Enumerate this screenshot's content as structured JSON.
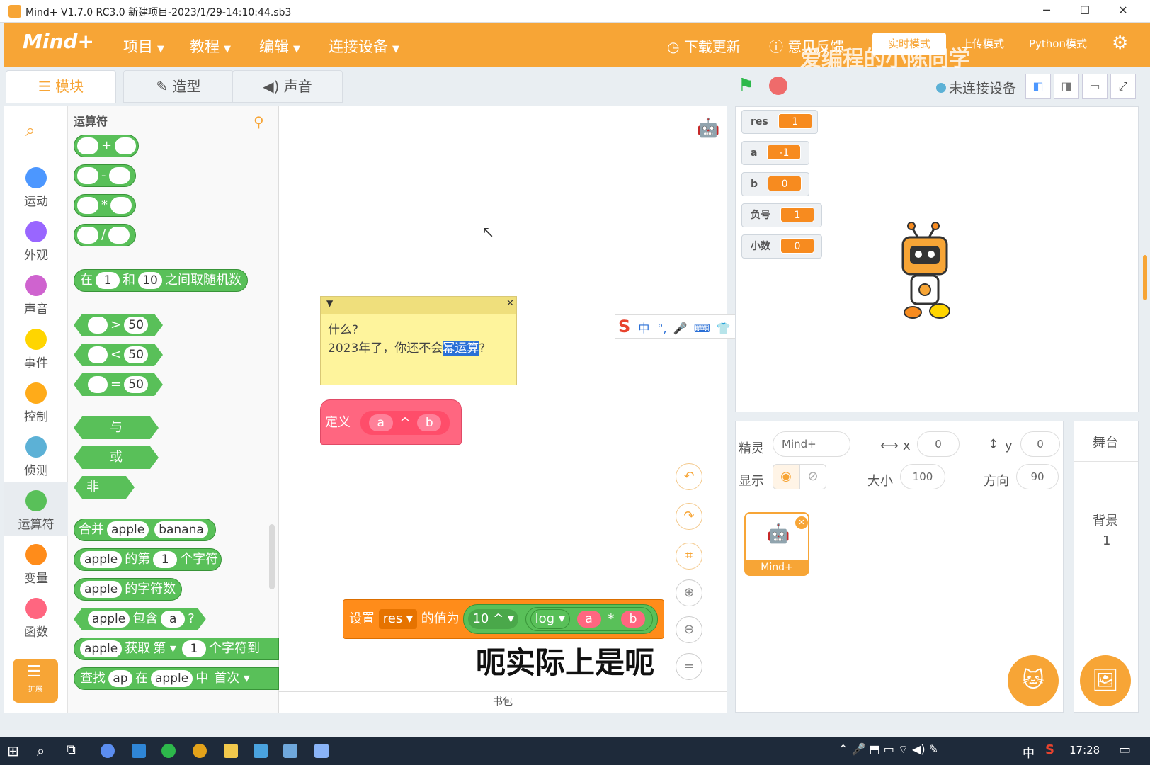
{
  "window": {
    "title": "Mind+ V1.7.0 RC3.0   新建项目-2023/1/29-14:10:44.sb3"
  },
  "menubar": {
    "logo": "Mind+",
    "items": [
      "项目",
      "教程",
      "编辑",
      "连接设备"
    ],
    "download": "下载更新",
    "feedback": "意见反馈",
    "mode_realtime": "实时模式",
    "mode_upload": "上传模式",
    "mode_python": "Python模式",
    "watermark": "爱编程的小陈同学"
  },
  "tabs": {
    "blocks": "模块",
    "costumes": "造型",
    "sounds": "声音"
  },
  "stage_header": {
    "connection": "未连接设备"
  },
  "categories": [
    {
      "label": "运动",
      "color": "#4c97ff"
    },
    {
      "label": "外观",
      "color": "#9966ff"
    },
    {
      "label": "声音",
      "color": "#cf63cf"
    },
    {
      "label": "事件",
      "color": "#ffd500"
    },
    {
      "label": "控制",
      "color": "#ffab19"
    },
    {
      "label": "侦测",
      "color": "#5cb1d6"
    },
    {
      "label": "运算符",
      "color": "#59c059"
    },
    {
      "label": "变量",
      "color": "#ff8c1a"
    },
    {
      "label": "函数",
      "color": "#ff6680"
    }
  ],
  "extensions_label": "扩展",
  "palette": {
    "title": "运算符",
    "ops": [
      "+",
      "-",
      "*",
      "/"
    ],
    "random": {
      "p1": "在",
      "v1": "1",
      "p2": "和",
      "v2": "10",
      "p3": "之间取随机数"
    },
    "compares": [
      {
        "op": ">",
        "v": "50"
      },
      {
        "op": "<",
        "v": "50"
      },
      {
        "op": "=",
        "v": "50"
      }
    ],
    "and": "与",
    "or": "或",
    "not": "非",
    "join": {
      "label": "合并",
      "a": "apple",
      "b": "banana"
    },
    "letter": {
      "a": "apple",
      "p1": "的第",
      "n": "1",
      "p2": "个字符"
    },
    "length": {
      "a": "apple",
      "p": "的字符数"
    },
    "contains": {
      "a": "apple",
      "p": "包含",
      "b": "a",
      "q": "?"
    },
    "get": {
      "a": "apple",
      "p": "获取",
      "mode": "第",
      "n": "1",
      "p2": "个字符到"
    },
    "find": {
      "p": "查找",
      "a": "ap",
      "p2": "在",
      "b": "apple",
      "p3": "中",
      "mode": "首次"
    }
  },
  "comment": {
    "line1": "什么?",
    "line2a": "2023年了，你还不会",
    "line2b": "幂运算",
    "line2c": "?"
  },
  "ime": [
    "中",
    "°,",
    "🎤",
    "⌨",
    "👕",
    "⊞"
  ],
  "define_block": {
    "label": "定义",
    "a": "a",
    "op": "^",
    "b": "b"
  },
  "set_block": {
    "label": "设置",
    "var": "res",
    "p": "的值为",
    "base": "10 ^",
    "fn": "log",
    "a": "a",
    "op": "*",
    "b": "b"
  },
  "subtitle": "呃实际上是呃",
  "backpack": "书包",
  "monitors": [
    {
      "name": "res",
      "value": "1"
    },
    {
      "name": "a",
      "value": "-1"
    },
    {
      "name": "b",
      "value": "0"
    },
    {
      "name": "负号",
      "value": "1"
    },
    {
      "name": "小数",
      "value": "0"
    }
  ],
  "sprite_info": {
    "sprite_label": "精灵",
    "sprite_name": "Mind+",
    "x_label": "x",
    "x": "0",
    "y_label": "y",
    "y": "0",
    "show_label": "显示",
    "size_label": "大小",
    "size": "100",
    "direction_label": "方向",
    "direction": "90",
    "thumb_name": "Mind+"
  },
  "stage_pane": {
    "title": "舞台",
    "backdrop_label": "背景",
    "backdrop_count": "1"
  },
  "taskbar": {
    "ime": "中",
    "time": "17:28"
  }
}
